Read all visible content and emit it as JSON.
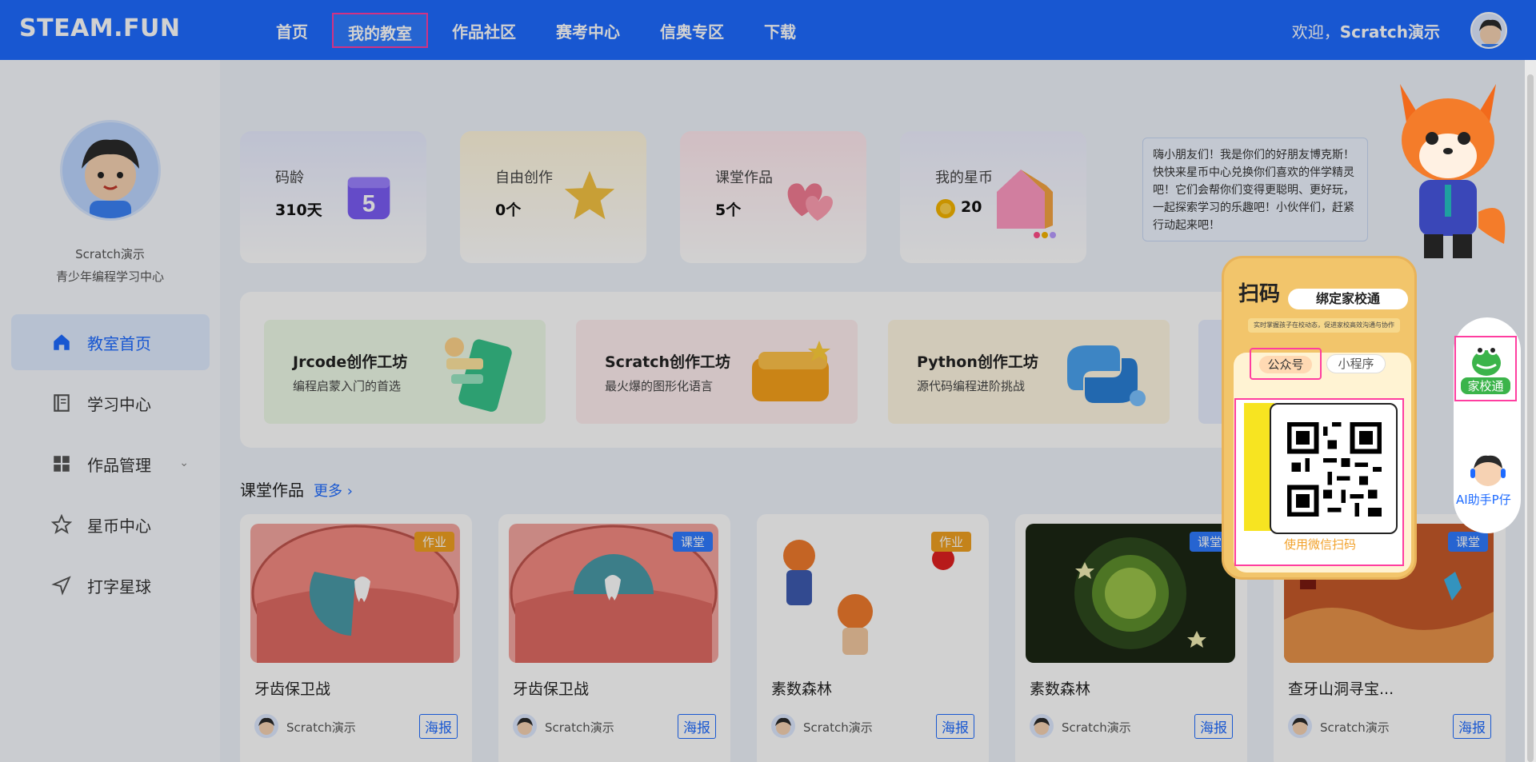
{
  "header": {
    "logo": "STEAM.FUN",
    "nav": [
      "首页",
      "我的教室",
      "作品社区",
      "赛考中心",
      "信奥专区",
      "下载"
    ],
    "welcome_prefix": "欢迎，",
    "welcome_user": "Scratch演示"
  },
  "sidebar": {
    "name": "Scratch演示",
    "org": "青少年编程学习中心",
    "items": [
      {
        "label": "教室首页",
        "icon": "home-icon"
      },
      {
        "label": "学习中心",
        "icon": "book-icon"
      },
      {
        "label": "作品管理",
        "icon": "grid-icon"
      },
      {
        "label": "星币中心",
        "icon": "star-icon"
      },
      {
        "label": "打字星球",
        "icon": "send-icon"
      }
    ]
  },
  "stats": [
    {
      "title": "码龄",
      "value": "310天"
    },
    {
      "title": "自由创作",
      "value": "0个"
    },
    {
      "title": "课堂作品",
      "value": "5个"
    },
    {
      "title": "我的星币",
      "value": "20"
    }
  ],
  "speech": "嗨小朋友们！我是你们的好朋友博克斯！快快来星币中心兑换你们喜欢的伴学精灵吧！它们会帮你们变得更聪明、更好玩，一起探索学习的乐趣吧！小伙伴们，赶紧行动起来吧！",
  "workshops": [
    {
      "title": "Jrcode创作工坊",
      "sub": "编程启蒙入门的首选"
    },
    {
      "title": "Scratch创作工坊",
      "sub": "最火爆的图形化语言"
    },
    {
      "title": "Python创作工坊",
      "sub": "源代码编程进阶挑战"
    }
  ],
  "class_works": {
    "title": "课堂作品",
    "more": "更多",
    "poster_label": "海报",
    "items": [
      {
        "title": "牙齿保卫战",
        "tag": "作业",
        "author": "Scratch演示"
      },
      {
        "title": "牙齿保卫战",
        "tag": "课堂",
        "author": "Scratch演示"
      },
      {
        "title": "素数森林",
        "tag": "作业",
        "author": "Scratch演示"
      },
      {
        "title": "素数森林",
        "tag": "课堂",
        "author": "Scratch演示"
      },
      {
        "title": "查牙山洞寻宝...",
        "tag": "课堂",
        "author": "Scratch演示"
      }
    ]
  },
  "popup": {
    "scan": "扫码",
    "bind": "绑定家校通",
    "subtitle": "实时掌握孩子在校动态，促进家校高效沟通与协作",
    "tab_public": "公众号",
    "tab_mini": "小程序",
    "hint": "使用微信扫码"
  },
  "float": {
    "jxt": "家校通",
    "ai": "AI助手P仔"
  },
  "colors": {
    "primary": "#1e6bff",
    "tag_homework": "#f0a020",
    "tag_class": "#2f7bff",
    "highlight": "#ff3ea0"
  }
}
